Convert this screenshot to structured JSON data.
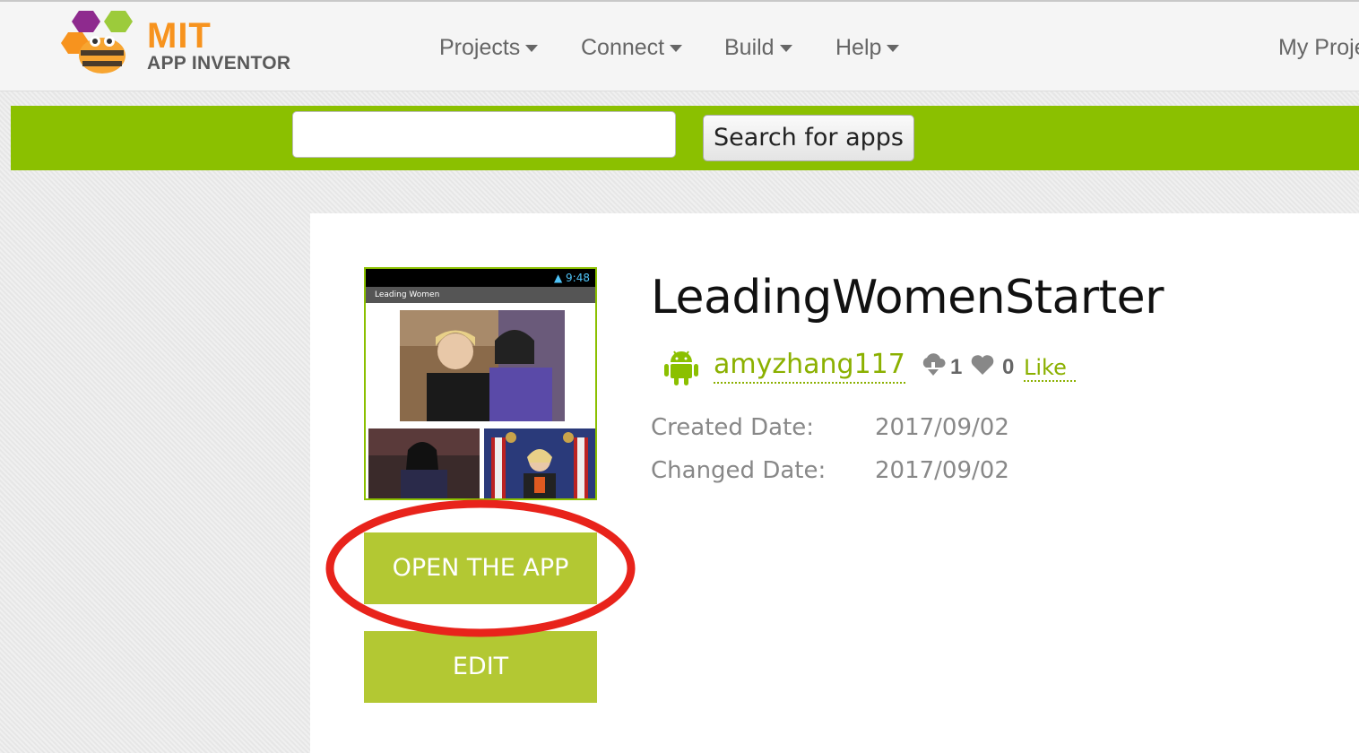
{
  "header": {
    "logo_title": "MIT",
    "logo_subtitle": "APP INVENTOR",
    "nav": [
      {
        "label": "Projects"
      },
      {
        "label": "Connect"
      },
      {
        "label": "Build"
      },
      {
        "label": "Help"
      }
    ],
    "my_projects": "My Proje"
  },
  "search": {
    "value": "",
    "button_label": "Search for apps"
  },
  "app": {
    "screenshot": {
      "status_time": "9:48",
      "title_bar": "Leading Women"
    },
    "open_button": "OPEN THE APP",
    "edit_button": "EDIT",
    "title": "LeadingWomenStarter",
    "author": "amyzhang117",
    "downloads": "1",
    "likes": "0",
    "like_link": "Like",
    "created_label": "Created Date:",
    "created_value": "2017/09/02",
    "changed_label": "Changed Date:",
    "changed_value": "2017/09/02"
  },
  "icons": [
    "app-inventor-logo-icon",
    "android-icon",
    "download-icon",
    "heart-icon"
  ],
  "colors": {
    "brand_green": "#8bc000",
    "button_green": "#b3c833",
    "logo_orange": "#f7931e",
    "highlight_red": "#e8231b"
  }
}
